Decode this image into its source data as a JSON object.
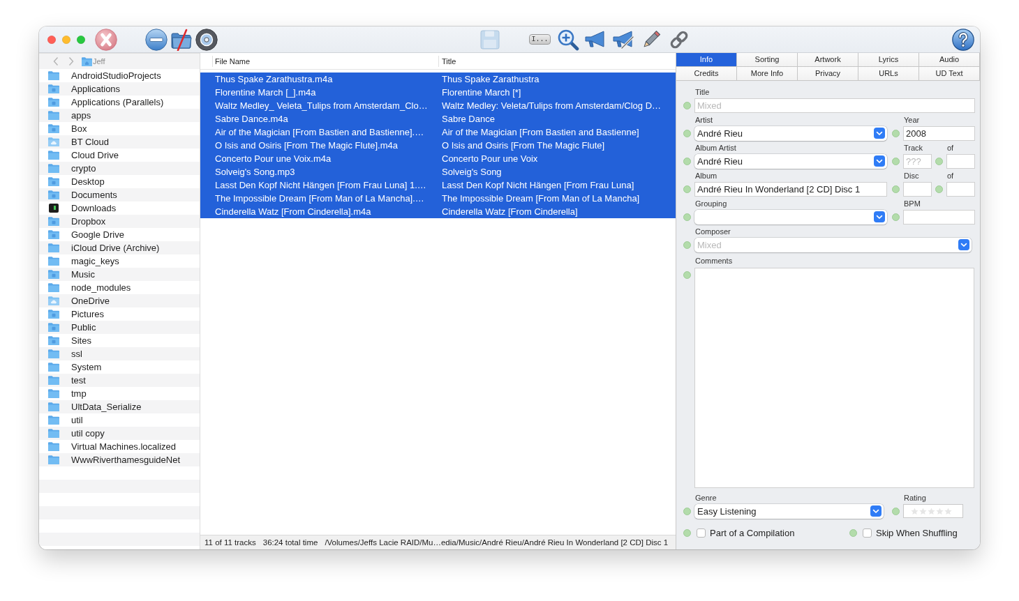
{
  "toolbar": {
    "text_button": "I..."
  },
  "sidebar": {
    "path": "Jeff",
    "items": [
      {
        "name": "AndroidStudioProjects",
        "kind": "folder"
      },
      {
        "name": "Applications",
        "kind": "emblem"
      },
      {
        "name": "Applications (Parallels)",
        "kind": "emblem"
      },
      {
        "name": "apps",
        "kind": "folder"
      },
      {
        "name": "Box",
        "kind": "emblem"
      },
      {
        "name": "BT Cloud",
        "kind": "cloud"
      },
      {
        "name": "Cloud Drive",
        "kind": "folder"
      },
      {
        "name": "crypto",
        "kind": "folder"
      },
      {
        "name": "Desktop",
        "kind": "emblem"
      },
      {
        "name": "Documents",
        "kind": "emblem"
      },
      {
        "name": "Downloads",
        "kind": "app"
      },
      {
        "name": "Dropbox",
        "kind": "emblem"
      },
      {
        "name": "Google Drive",
        "kind": "emblem"
      },
      {
        "name": "iCloud Drive (Archive)",
        "kind": "folder"
      },
      {
        "name": "magic_keys",
        "kind": "folder"
      },
      {
        "name": "Music",
        "kind": "emblem"
      },
      {
        "name": "node_modules",
        "kind": "folder"
      },
      {
        "name": "OneDrive",
        "kind": "cloud"
      },
      {
        "name": "Pictures",
        "kind": "emblem"
      },
      {
        "name": "Public",
        "kind": "emblem"
      },
      {
        "name": "Sites",
        "kind": "emblem"
      },
      {
        "name": "ssl",
        "kind": "folder"
      },
      {
        "name": "System",
        "kind": "folder"
      },
      {
        "name": "test",
        "kind": "folder"
      },
      {
        "name": "tmp",
        "kind": "folder"
      },
      {
        "name": "UltData_Serialize",
        "kind": "folder"
      },
      {
        "name": "util",
        "kind": "folder"
      },
      {
        "name": "util copy",
        "kind": "folder"
      },
      {
        "name": "Virtual Machines.localized",
        "kind": "folder"
      },
      {
        "name": "WwwRiverthamesguideNet",
        "kind": "folder"
      }
    ]
  },
  "table": {
    "columns": [
      "File Name",
      "Title"
    ],
    "rows": [
      {
        "file_name": "Thus Spake Zarathustra.m4a",
        "title": "Thus Spake Zarathustra",
        "selected": true
      },
      {
        "file_name": "Florentine March [_].m4a",
        "title": "Florentine March [*]",
        "selected": true
      },
      {
        "file_name": "Waltz Medley_ Veleta_Tulips from Amsterdam_Clo…",
        "title": "Waltz Medley: Veleta/Tulips from Amsterdam/Clog D…",
        "selected": true
      },
      {
        "file_name": "Sabre Dance.m4a",
        "title": "Sabre Dance",
        "selected": true
      },
      {
        "file_name": "Air of the Magician [From Bastien and Bastienne].…",
        "title": "Air of the Magician [From Bastien and Bastienne]",
        "selected": true
      },
      {
        "file_name": "O Isis and Osiris [From The Magic Flute].m4a",
        "title": "O Isis and Osiris [From The Magic Flute]",
        "selected": true
      },
      {
        "file_name": "Concerto Pour une Voix.m4a",
        "title": "Concerto Pour une Voix",
        "selected": true
      },
      {
        "file_name": "Solveig's Song.mp3",
        "title": "Solveig's Song",
        "selected": true
      },
      {
        "file_name": "Lasst Den Kopf Nicht Hängen [From Frau Luna] 1.…",
        "title": "Lasst Den Kopf Nicht Hängen [From Frau Luna]",
        "selected": true
      },
      {
        "file_name": "The Impossible Dream [From Man of La Mancha].…",
        "title": "The Impossible Dream [From Man of La Mancha]",
        "selected": true
      },
      {
        "file_name": "Cinderella Watz [From Cinderella].m4a",
        "title": "Cinderella Watz [From Cinderella]",
        "selected": true
      }
    ]
  },
  "status_bar": {
    "track_count": "11 of 11 tracks",
    "total_time": "36:24 total time",
    "path": "/Volumes/Jeffs Lacie RAID/Mu…edia/Music/André Rieu/André Rieu In Wonderland [2 CD] Disc 1"
  },
  "inspector": {
    "tabs": [
      {
        "label": "Info",
        "selected": true
      },
      {
        "label": "Sorting",
        "selected": false
      },
      {
        "label": "Artwork",
        "selected": false
      },
      {
        "label": "Lyrics",
        "selected": false
      },
      {
        "label": "Audio",
        "selected": false
      },
      {
        "label": "Credits",
        "selected": false
      },
      {
        "label": "More Info",
        "selected": false
      },
      {
        "label": "Privacy",
        "selected": false
      },
      {
        "label": "URLs",
        "selected": false
      },
      {
        "label": "UD Text",
        "selected": false
      }
    ],
    "fields": {
      "title": {
        "label": "Title",
        "kind": "text",
        "placeholder": "Mixed"
      },
      "artist": {
        "label": "Artist",
        "kind": "dropdown",
        "value": "André Rieu"
      },
      "year": {
        "label": "Year",
        "kind": "text",
        "value": "2008"
      },
      "album_artist": {
        "label": "Album Artist",
        "kind": "dropdown",
        "value": "André Rieu"
      },
      "track": {
        "label": "Track",
        "kind": "text",
        "placeholder": "???"
      },
      "track_total": {
        "label": "of",
        "kind": "text"
      },
      "album": {
        "label": "Album",
        "kind": "text",
        "value": "André Rieu In Wonderland [2 CD] Disc 1"
      },
      "disc": {
        "label": "Disc",
        "kind": "text"
      },
      "disc_total": {
        "label": "of",
        "kind": "text"
      },
      "grouping": {
        "label": "Grouping",
        "kind": "dropdown"
      },
      "bpm": {
        "label": "BPM",
        "kind": "text"
      },
      "composer": {
        "label": "Composer",
        "kind": "dropdown",
        "placeholder": "Mixed"
      },
      "comments": {
        "label": "Comments",
        "kind": "area"
      },
      "genre": {
        "label": "Genre",
        "kind": "dropdown",
        "value": "Easy Listening"
      },
      "rating": {
        "label": "Rating",
        "kind": "rating",
        "stars": 0
      },
      "compilation": {
        "label": "Part of a Compilation",
        "kind": "checkbox",
        "checked": false
      },
      "skip_when_shuffling": {
        "label": "Skip When Shuffling",
        "kind": "checkbox",
        "checked": false
      }
    }
  }
}
